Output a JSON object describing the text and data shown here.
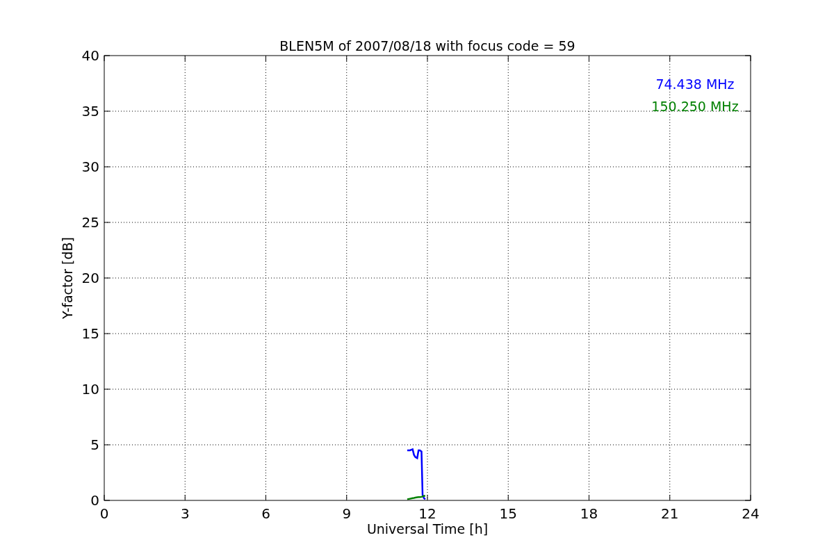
{
  "figure": {
    "chart_data": {
      "type": "line",
      "title": "BLEN5M of 2007/08/18 with focus code = 59",
      "xlabel": "Universal Time [h]",
      "ylabel": "Y-factor [dB]",
      "grid": true,
      "xlim": [
        0,
        24
      ],
      "ylim": [
        0,
        40
      ],
      "xticks": [
        0,
        3,
        6,
        9,
        12,
        15,
        18,
        21,
        24
      ],
      "yticks": [
        0,
        5,
        10,
        15,
        20,
        25,
        30,
        35,
        40
      ],
      "x": [
        11.25,
        11.35,
        11.45,
        11.5,
        11.55,
        11.62,
        11.67,
        11.72,
        11.78,
        11.82,
        11.87,
        11.92
      ],
      "series": [
        {
          "name": "74.438 MHz",
          "color": "#0000ff",
          "values": [
            4.5,
            4.5,
            4.6,
            4.1,
            3.9,
            3.8,
            4.5,
            4.5,
            4.4,
            0.5,
            0.2,
            0.1
          ]
        },
        {
          "name": "150.250 MHz",
          "color": "#008000",
          "values": [
            0.1,
            0.15,
            0.2,
            0.22,
            0.25,
            0.28,
            0.3,
            0.3,
            0.32,
            0.35,
            0.4,
            0.4
          ]
        }
      ]
    }
  }
}
